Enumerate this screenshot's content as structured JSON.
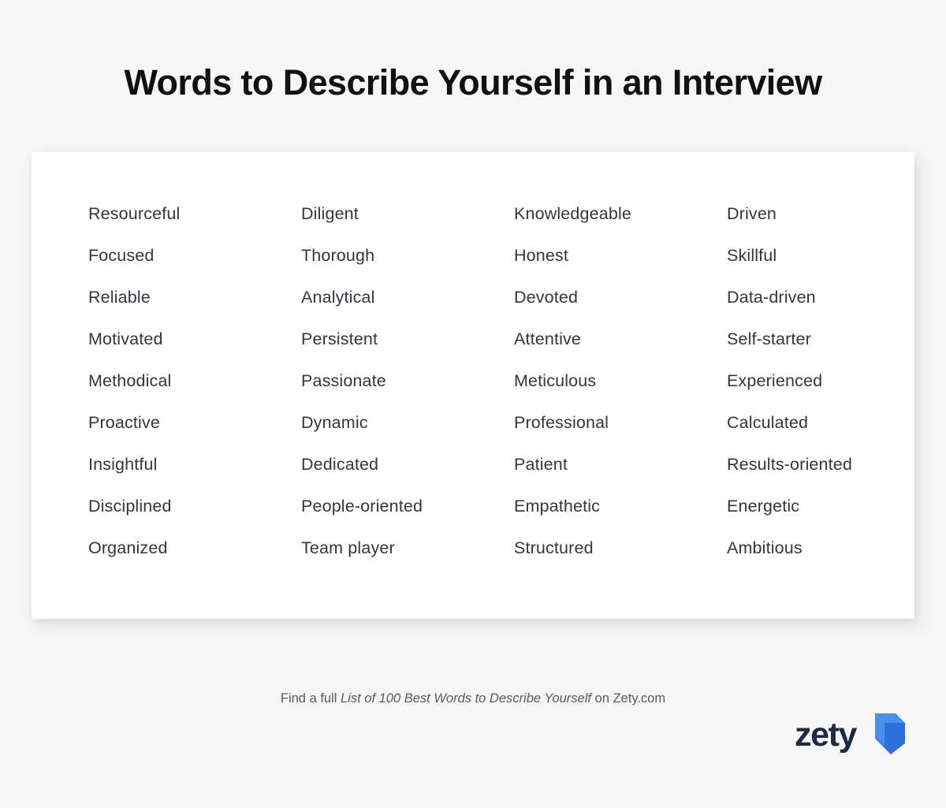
{
  "page": {
    "background_color": "#f6f6f6",
    "card_color": "#ffffff"
  },
  "header": {
    "title": "Words to Describe Yourself in an Interview",
    "title_color": "#111111"
  },
  "card": {
    "columns": [
      {
        "words": [
          "Resourceful",
          "Focused",
          "Reliable",
          "Motivated",
          "Methodical",
          "Proactive",
          "Insightful",
          "Disciplined",
          "Organized"
        ]
      },
      {
        "words": [
          "Diligent",
          "Thorough",
          "Analytical",
          "Persistent",
          "Passionate",
          "Dynamic",
          "Dedicated",
          "People-oriented",
          "Team player"
        ]
      },
      {
        "words": [
          "Knowledgeable",
          "Honest",
          "Devoted",
          "Attentive",
          "Meticulous",
          "Professional",
          "Patient",
          "Empathetic",
          "Structured"
        ]
      },
      {
        "words": [
          "Driven",
          "Skillful",
          "Data-driven",
          "Self-starter",
          "Experienced",
          "Calculated",
          "Results-oriented",
          "Energetic",
          "Ambitious"
        ]
      }
    ]
  },
  "footer": {
    "caption_prefix": "Find a full ",
    "caption_emphasis": "List of 100 Best Words to Describe Yourself",
    "caption_suffix": " on Zety.com",
    "caption_color": "#555a60"
  },
  "logo": {
    "wordmark": "zety",
    "wordmark_color": "#1f2847",
    "mark_icon": "zety-chevron-icon",
    "mark_color_light": "#4a8ef0",
    "mark_color_dark": "#2f6fd8"
  }
}
